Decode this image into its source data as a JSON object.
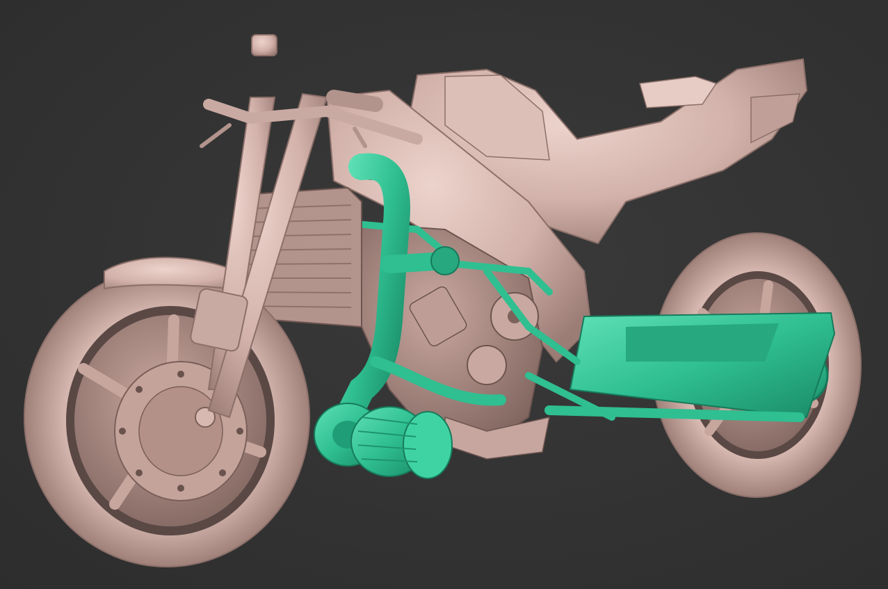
{
  "viewport": {
    "background": "#333333",
    "render_style": "sculpt matcap preview"
  },
  "model": {
    "subject": "motorcycle",
    "base_material_color": "#d2b2aa",
    "highlight_material_color": "#2fbf91",
    "highlighted_parts": [
      "turbo-intake-pipe",
      "turbocharger",
      "air-filter",
      "trellis-subframe",
      "swingarm",
      "rear-sprocket"
    ]
  }
}
